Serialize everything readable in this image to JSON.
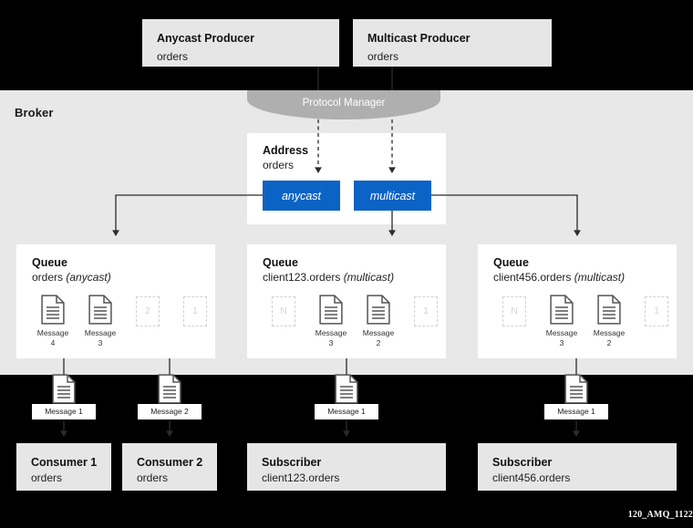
{
  "diagram": {
    "title": "AMQ Broker anycast and multicast routing",
    "watermark": "120_AMQ_1122",
    "colors": {
      "background_black": "#000000",
      "broker_gray": "#E8E8E8",
      "box_gray": "#E6E6E6",
      "routing_blue": "#0B63C5",
      "protocol_manager_gray": "#AFAFAF",
      "white": "#FFFFFF",
      "ghost_dash": "#D2D2D2"
    }
  },
  "producers": [
    {
      "title": "Anycast Producer",
      "address": "orders"
    },
    {
      "title": "Multicast Producer",
      "address": "orders"
    }
  ],
  "broker": {
    "label": "Broker",
    "protocol_manager": {
      "label": "Protocol Manager"
    },
    "address": {
      "title": "Address",
      "name": "orders",
      "routing_types": [
        {
          "label": "anycast"
        },
        {
          "label": "multicast"
        }
      ]
    },
    "queues": [
      {
        "title": "Queue",
        "name": "orders",
        "routing_type": "(anycast)",
        "slots": [
          {
            "kind": "message",
            "label": "Message",
            "number": "4"
          },
          {
            "kind": "message",
            "label": "Message",
            "number": "3"
          },
          {
            "kind": "ghost",
            "label": "2"
          },
          {
            "kind": "ghost",
            "label": "1"
          }
        ]
      },
      {
        "title": "Queue",
        "name": "client123.orders",
        "routing_type": "(multicast)",
        "slots": [
          {
            "kind": "ghost",
            "label": "N"
          },
          {
            "kind": "message",
            "label": "Message",
            "number": "3"
          },
          {
            "kind": "message",
            "label": "Message",
            "number": "2"
          },
          {
            "kind": "ghost",
            "label": "1"
          }
        ]
      },
      {
        "title": "Queue",
        "name": "client456.orders",
        "routing_type": "(multicast)",
        "slots": [
          {
            "kind": "ghost",
            "label": "N"
          },
          {
            "kind": "message",
            "label": "Message",
            "number": "3"
          },
          {
            "kind": "message",
            "label": "Message",
            "number": "2"
          },
          {
            "kind": "ghost",
            "label": "1"
          }
        ]
      }
    ]
  },
  "delivery": [
    {
      "message": "Message 1"
    },
    {
      "message": "Message 2"
    },
    {
      "message": "Message 1"
    },
    {
      "message": "Message 1"
    }
  ],
  "consumers": [
    {
      "title": "Consumer 1",
      "address": "orders"
    },
    {
      "title": "Consumer 2",
      "address": "orders"
    },
    {
      "title": "Subscriber",
      "address": "client123.orders"
    },
    {
      "title": "Subscriber",
      "address": "client456.orders"
    }
  ]
}
